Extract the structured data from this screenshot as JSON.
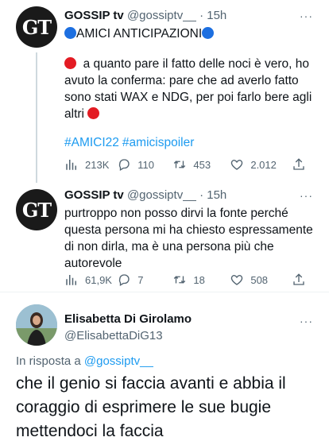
{
  "tweets": [
    {
      "author_name": "GOSSIP tv",
      "handle": "@gossiptv__",
      "separator": "·",
      "time": "15h",
      "avatar_text": "GT",
      "title": "AMICI ANTICIPAZIONI",
      "text": "a quanto pare il fatto delle noci è vero, ho avuto la conferma: pare che ad averlo fatto sono stati WAX e NDG, per poi farlo bere agli altri",
      "hashtags": [
        "#AMICI22",
        "#amicispoiler"
      ],
      "stats": {
        "views": "213K",
        "replies": "110",
        "retweets": "453",
        "likes": "2.012"
      }
    },
    {
      "author_name": "GOSSIP tv",
      "handle": "@gossiptv__",
      "separator": "·",
      "time": "15h",
      "avatar_text": "GT",
      "text": "purtroppo non posso dirvi la fonte perché questa persona mi ha chiesto espressamente di non dirla, ma è una persona più che autorevole",
      "stats": {
        "views": "61,9K",
        "replies": "7",
        "retweets": "18",
        "likes": "508"
      }
    }
  ],
  "reply": {
    "author_name": "Elisabetta Di Girolamo",
    "handle": "@ElisabettaDiG13",
    "reply_label": "In risposta a",
    "reply_to": "@gossiptv__",
    "text": "che il genio si faccia avanti e abbia il coraggio di esprimere le sue bugie mettendoci la faccia"
  },
  "more_icon": "···",
  "colors": {
    "link": "#1d9bf0",
    "muted": "#536471",
    "blue_emoji": "#1d6fe0",
    "red_emoji": "#e31b23"
  }
}
